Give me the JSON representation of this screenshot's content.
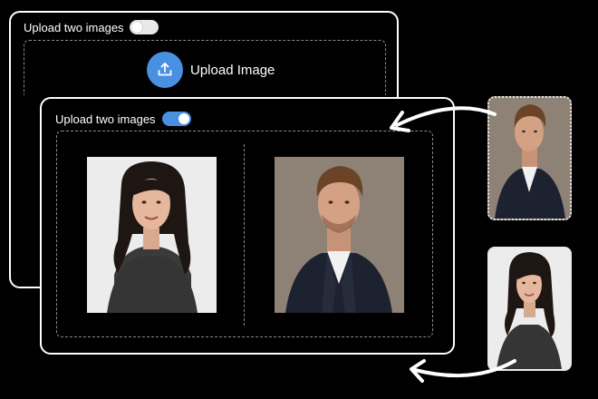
{
  "back_window": {
    "toggle_label": "Upload two images",
    "toggle_state": "off",
    "upload_button_label": "Upload Image",
    "upload_icon": "upload-icon"
  },
  "front_window": {
    "toggle_label": "Upload two images",
    "toggle_state": "on",
    "images": [
      {
        "subject": "woman-portrait"
      },
      {
        "subject": "man-portrait"
      }
    ]
  },
  "side_thumbnails": [
    {
      "subject": "man-portrait"
    },
    {
      "subject": "woman-portrait"
    }
  ],
  "colors": {
    "accent": "#4a90e2",
    "background": "#000000",
    "border": "#ffffff"
  }
}
